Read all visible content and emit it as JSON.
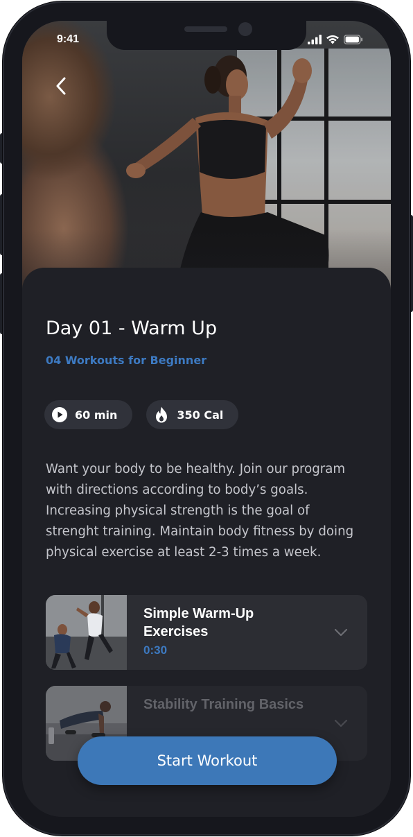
{
  "status_bar": {
    "time": "9:41",
    "icons": [
      "cellular-signal-icon",
      "wifi-icon",
      "battery-icon"
    ]
  },
  "nav": {
    "back_icon": "chevron-left-icon"
  },
  "workout_day": {
    "title": "Day 01 - Warm Up",
    "subtitle": "04 Workouts for Beginner",
    "stats": [
      {
        "icon": "play-icon",
        "label": "60 min"
      },
      {
        "icon": "flame-icon",
        "label": "350 Cal"
      }
    ],
    "description": "Want your body to be healthy. Join our program with directions according to body’s goals. Increasing physical strength is the goal of strenght training. Maintain body fitness by doing physical exercise at least 2-3 times a week."
  },
  "workouts": [
    {
      "name": "Simple Warm-Up Exercises",
      "duration": "0:30",
      "icon": "chevron-down-icon"
    },
    {
      "name": "Stability Training Basics",
      "duration": "",
      "icon": "chevron-down-icon"
    }
  ],
  "actions": {
    "start_label": "Start Workout"
  },
  "colors": {
    "background": "#1f2026",
    "accent": "#3d7ac2",
    "button": "#3d78b8",
    "chip": "#30323a",
    "card": "#2c2d33"
  }
}
